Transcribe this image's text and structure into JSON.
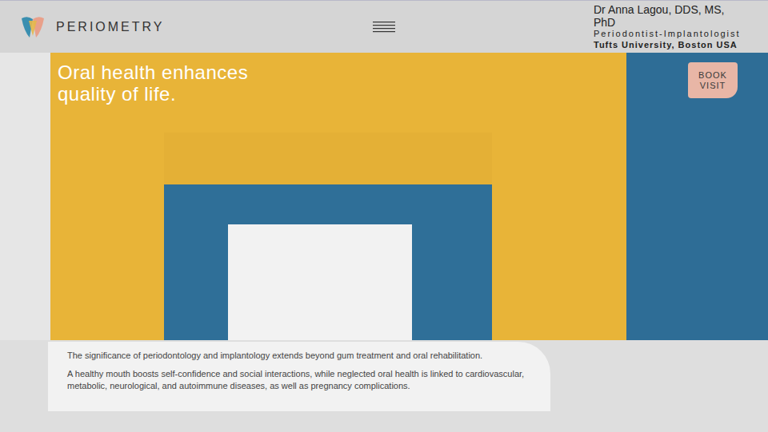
{
  "header": {
    "logo": "PERIOMETRY",
    "doctor": {
      "name": "Dr Anna Lagou, DDS, MS, PhD",
      "title": "Periodontist-Implantologist",
      "affiliation": "Tufts University, Boston USA"
    }
  },
  "hero": {
    "headline": "Oral health enhances quality of life.",
    "book_button": "BOOK VISIT",
    "paragraphs": [
      "The significance of periodontology and implantology extends beyond gum treatment and oral rehabilitation.",
      "A healthy mouth boosts self-confidence and social interactions, while neglected oral health is linked to cardiovascular, metabolic, neurological, and autoimmune diseases, as well as pregnancy complications."
    ]
  }
}
